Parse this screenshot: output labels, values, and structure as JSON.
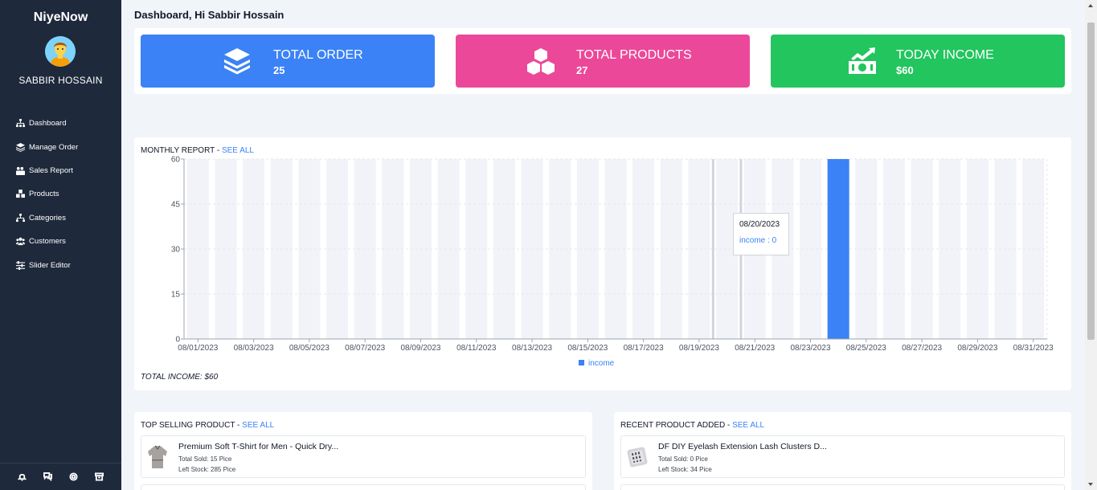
{
  "sidebar": {
    "brand": "NiyeNow",
    "user_name": "SABBIR HOSSAIN",
    "items": [
      {
        "label": "Dashboard",
        "icon": "sitemap-icon"
      },
      {
        "label": "Manage Order",
        "icon": "layers-icon"
      },
      {
        "label": "Sales Report",
        "icon": "report-icon"
      },
      {
        "label": "Products",
        "icon": "cubes-icon"
      },
      {
        "label": "Categories",
        "icon": "hierarchy-icon"
      },
      {
        "label": "Customers",
        "icon": "users-icon"
      },
      {
        "label": "Slider Editor",
        "icon": "sliders-icon"
      }
    ],
    "footer_icons": [
      "bell-icon",
      "chat-icon",
      "settings-icon",
      "archive-icon"
    ]
  },
  "header": {
    "title": "Dashboard, Hi Sabbir Hossain"
  },
  "stats": [
    {
      "label": "TOTAL ORDER",
      "value": "25",
      "color": "#3b82f6",
      "icon": "layers-icon"
    },
    {
      "label": "TOTAL PRODUCTS",
      "value": "27",
      "color": "#ec4899",
      "icon": "cubes-icon"
    },
    {
      "label": "TODAY INCOME",
      "value": "$60",
      "color": "#22c55e",
      "icon": "money-growth-icon"
    }
  ],
  "report": {
    "title": "MONTHLY REPORT - ",
    "see_all": "SEE ALL",
    "total_income": "TOTAL INCOME: $60",
    "tooltip": {
      "date": "08/20/2023",
      "value": "income : 0"
    }
  },
  "chart_data": {
    "type": "bar",
    "categories": [
      "08/01/2023",
      "08/02/2023",
      "08/03/2023",
      "08/04/2023",
      "08/05/2023",
      "08/06/2023",
      "08/07/2023",
      "08/08/2023",
      "08/09/2023",
      "08/10/2023",
      "08/11/2023",
      "08/12/2023",
      "08/13/2023",
      "08/14/2023",
      "08/15/2023",
      "08/16/2023",
      "08/17/2023",
      "08/18/2023",
      "08/19/2023",
      "08/20/2023",
      "08/21/2023",
      "08/22/2023",
      "08/23/2023",
      "08/24/2023",
      "08/25/2023",
      "08/26/2023",
      "08/27/2023",
      "08/28/2023",
      "08/29/2023",
      "08/30/2023",
      "08/31/2023"
    ],
    "tick_labels": [
      "08/01/2023",
      "08/03/2023",
      "08/05/2023",
      "08/07/2023",
      "08/09/2023",
      "08/11/2023",
      "08/13/2023",
      "08/15/2023",
      "08/17/2023",
      "08/19/2023",
      "08/21/2023",
      "08/23/2023",
      "08/25/2023",
      "08/27/2023",
      "08/29/2023",
      "08/31/2023"
    ],
    "series": [
      {
        "name": "income",
        "color": "#3b82f6",
        "values": [
          0,
          0,
          0,
          0,
          0,
          0,
          0,
          0,
          0,
          0,
          0,
          0,
          0,
          0,
          0,
          0,
          0,
          0,
          0,
          0,
          0,
          0,
          0,
          60,
          0,
          0,
          0,
          0,
          0,
          0,
          0
        ]
      }
    ],
    "yticks": [
      0,
      15,
      30,
      45,
      60
    ],
    "ylim": [
      0,
      60
    ],
    "legend": "bottom",
    "grid": true
  },
  "top_selling": {
    "title": "TOP SELLING PRODUCT - ",
    "see_all": "SEE ALL",
    "items": [
      {
        "name": "Premium Soft T-Shirt for Men - Quick Dry...",
        "sold": "Total Sold: 15 Pice",
        "stock": "Left Stock: 285 Pice"
      }
    ]
  },
  "recent_products": {
    "title": "RECENT PRODUCT ADDED - ",
    "see_all": "SEE ALL",
    "items": [
      {
        "name": "DF DIY Eyelash Extension Lash Clusters D...",
        "sold": "Total Sold: 0 Pice",
        "stock": "Left Stock: 34 Pice"
      }
    ]
  }
}
